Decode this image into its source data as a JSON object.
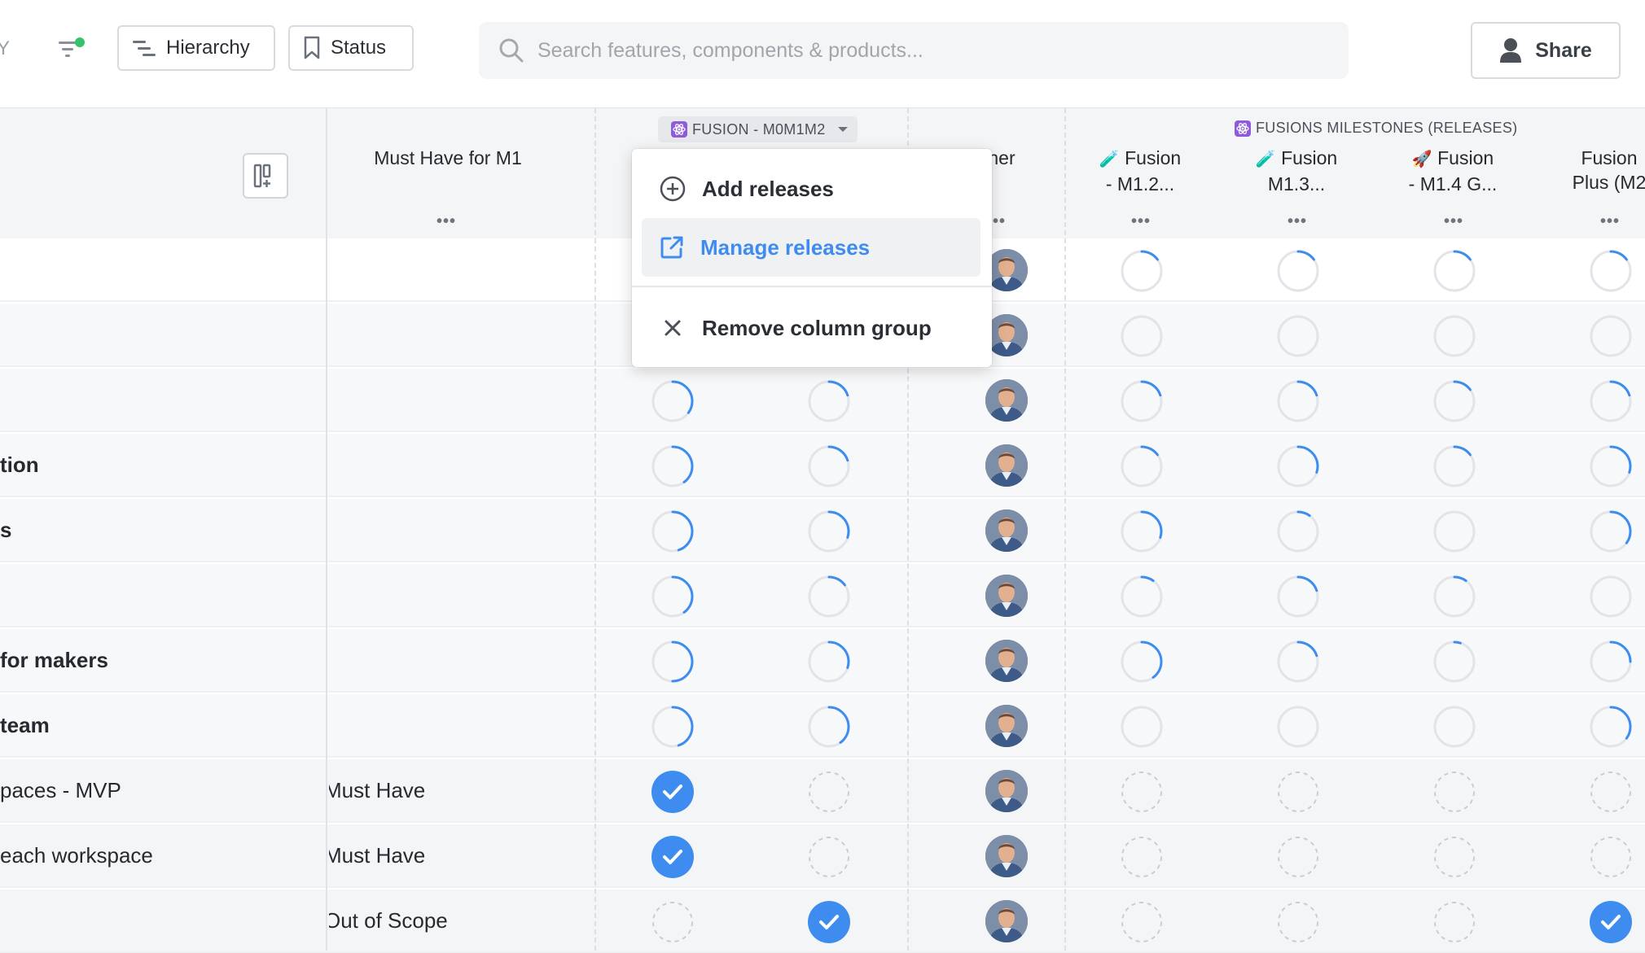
{
  "toolbar": {
    "cut_label": "Y",
    "filter_icon": "filter-icon",
    "hierarchy_label": "Hierarchy",
    "status_label": "Status",
    "search_placeholder": "Search features, components & products...",
    "share_label": "Share"
  },
  "header": {
    "group1_label": "FUSION - M0M1M2",
    "group2_label": "FUSIONS MILESTONES (RELEASES)",
    "columns": [
      {
        "title": "Must Have for M1"
      },
      {
        "title": "ner"
      },
      {
        "title_line1": "Fusion",
        "title_line2": "- M1.2...",
        "emoji": "🧪"
      },
      {
        "title_line1": "Fusion",
        "title_line2": "M1.3...",
        "emoji": "🧪"
      },
      {
        "title_line1": "Fusion",
        "title_line2": "- M1.4 G...",
        "emoji": "🚀"
      },
      {
        "title_line1": "Fusion",
        "title_line2": "Plus (M2"
      }
    ],
    "menu_dots": "•••"
  },
  "dropdown": {
    "add_label": "Add releases",
    "manage_label": "Manage releases",
    "remove_label": "Remove column group"
  },
  "rows": [
    {
      "name": "",
      "bold": false,
      "priority": ""
    },
    {
      "name": "",
      "bold": false,
      "priority": ""
    },
    {
      "name": "",
      "bold": false,
      "priority": ""
    },
    {
      "name": "tion",
      "bold": true,
      "priority": ""
    },
    {
      "name": "s",
      "bold": true,
      "priority": ""
    },
    {
      "name": "",
      "bold": false,
      "priority": ""
    },
    {
      "name": "for makers",
      "bold": true,
      "priority": ""
    },
    {
      "name": "team",
      "bold": true,
      "priority": ""
    },
    {
      "name": "paces - MVP",
      "bold": false,
      "priority": "Must Have"
    },
    {
      "name": "each workspace",
      "bold": false,
      "priority": "Must Have"
    },
    {
      "name": "",
      "bold": false,
      "priority": "Out of Scope"
    }
  ],
  "colors": {
    "accent": "#3f8cf0",
    "progress_track": "#e1e4e8",
    "check_fill": "#3f8cf0"
  }
}
